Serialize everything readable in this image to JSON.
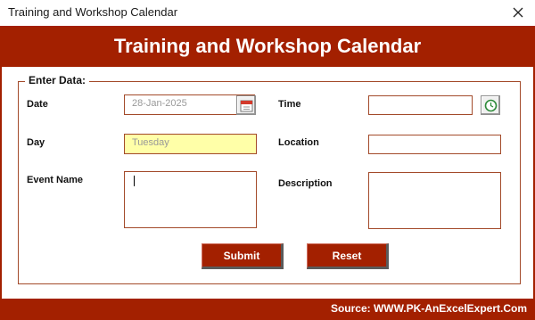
{
  "window": {
    "title": "Training and Workshop Calendar",
    "close_icon": "close-icon"
  },
  "banner": {
    "title": "Training and Workshop Calendar"
  },
  "frame": {
    "legend": "Enter Data:"
  },
  "fields": {
    "date": {
      "label": "Date",
      "value": "28-Jan-2025",
      "icon": "calendar-icon"
    },
    "time": {
      "label": "Time",
      "value": "",
      "icon": "clock-icon"
    },
    "day": {
      "label": "Day",
      "value": "Tuesday"
    },
    "location": {
      "label": "Location",
      "value": ""
    },
    "event_name": {
      "label": "Event Name",
      "value": ""
    },
    "description": {
      "label": "Description",
      "value": ""
    }
  },
  "buttons": {
    "submit": "Submit",
    "reset": "Reset"
  },
  "footer": {
    "source": "Source: WWW.PK-AnExcelExpert.Com"
  },
  "colors": {
    "accent": "#a32000",
    "field_border": "#a34a2a",
    "day_field_bg": "#ffffa8"
  }
}
